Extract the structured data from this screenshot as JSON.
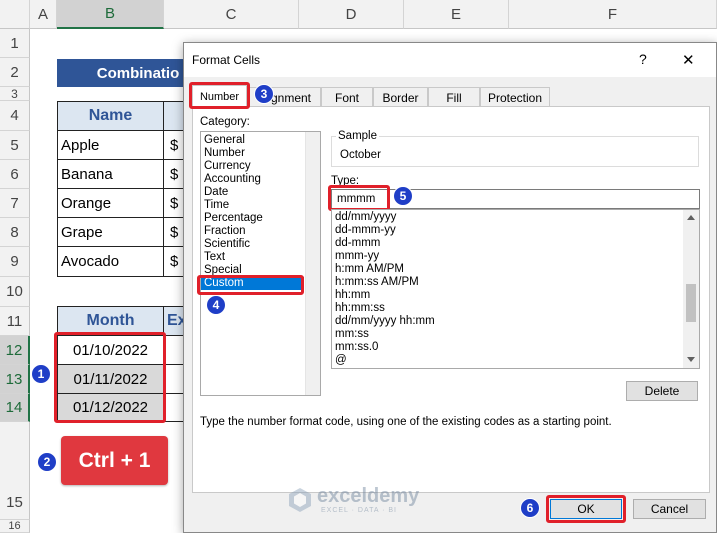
{
  "sheet": {
    "columns": [
      "A",
      "B",
      "C",
      "D",
      "E",
      "F"
    ],
    "rows": [
      "1",
      "2",
      "3",
      "4",
      "5",
      "6",
      "7",
      "8",
      "9",
      "10",
      "11",
      "12",
      "13",
      "14",
      "15",
      "16"
    ],
    "title": "Combinatio",
    "table1": {
      "headers": [
        "Name"
      ],
      "names": [
        "Apple",
        "Banana",
        "Orange",
        "Grape",
        "Avocado"
      ],
      "currency": "$"
    },
    "table2": {
      "headers": [
        "Month",
        "Ex"
      ],
      "dates": [
        "01/10/2022",
        "01/11/2022",
        "01/12/2022"
      ]
    },
    "shortcut": "Ctrl + 1"
  },
  "dialog": {
    "title": "Format Cells",
    "help": "?",
    "close": "✕",
    "tabs": [
      "Number",
      "gnment",
      "Font",
      "Border",
      "Fill",
      "Protection"
    ],
    "category_label": "Category:",
    "categories": [
      "General",
      "Number",
      "Currency",
      "Accounting",
      "Date",
      "Time",
      "Percentage",
      "Fraction",
      "Scientific",
      "Text",
      "Special",
      "Custom"
    ],
    "sample_label": "Sample",
    "sample_value": "October",
    "type_label": "Type:",
    "type_value": "mmmm",
    "formats": [
      "dd/mm/yyyy",
      "dd-mmm-yy",
      "dd-mmm",
      "mmm-yy",
      "h:mm AM/PM",
      "h:mm:ss AM/PM",
      "hh:mm",
      "hh:mm:ss",
      "dd/mm/yyyy hh:mm",
      "mm:ss",
      "mm:ss.0",
      "@"
    ],
    "delete_label": "Delete",
    "hint": "Type the number format code, using one of the existing codes as a starting point.",
    "ok_label": "OK",
    "cancel_label": "Cancel"
  },
  "badges": [
    "1",
    "2",
    "3",
    "4",
    "5",
    "6"
  ],
  "watermark": {
    "name": "exceldemy",
    "tagline": "EXCEL · DATA · BI"
  },
  "colors": {
    "accent_red": "#e0202a",
    "badge_blue": "#1f3ec7",
    "header_fill": "#dce6f1",
    "title_fill": "#2f5597",
    "selected_gray": "#d9d9d9",
    "selection_blue": "#0078d7"
  }
}
